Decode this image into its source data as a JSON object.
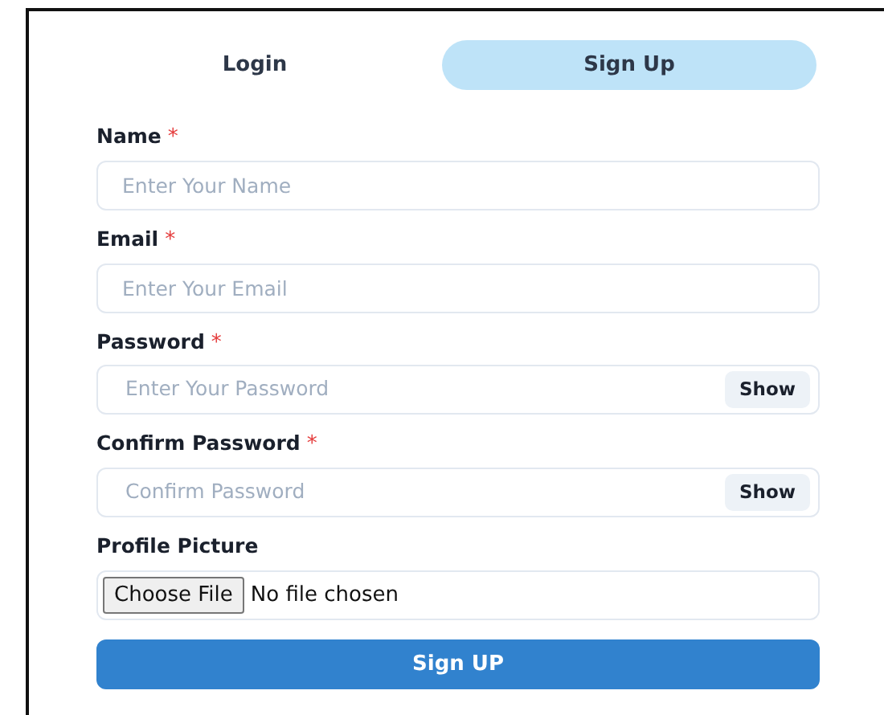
{
  "tabs": [
    {
      "label": "Login",
      "selected": false
    },
    {
      "label": "Sign Up",
      "selected": true
    }
  ],
  "fields": [
    {
      "kind": "text",
      "label": "Name",
      "required_mark": "*",
      "placeholder": "Enter Your Name"
    },
    {
      "kind": "text",
      "label": "Email",
      "required_mark": "*",
      "placeholder": "Enter Your Email"
    },
    {
      "kind": "password",
      "label": "Password",
      "required_mark": "*",
      "placeholder": "Enter Your Password",
      "toggle": "Show"
    },
    {
      "kind": "password",
      "label": "Confirm Password",
      "required_mark": "*",
      "placeholder": "Confirm Password",
      "toggle": "Show"
    },
    {
      "kind": "file",
      "label": "Profile Picture",
      "button": "Choose File",
      "status": "No file chosen"
    }
  ],
  "submit": "Sign UP"
}
